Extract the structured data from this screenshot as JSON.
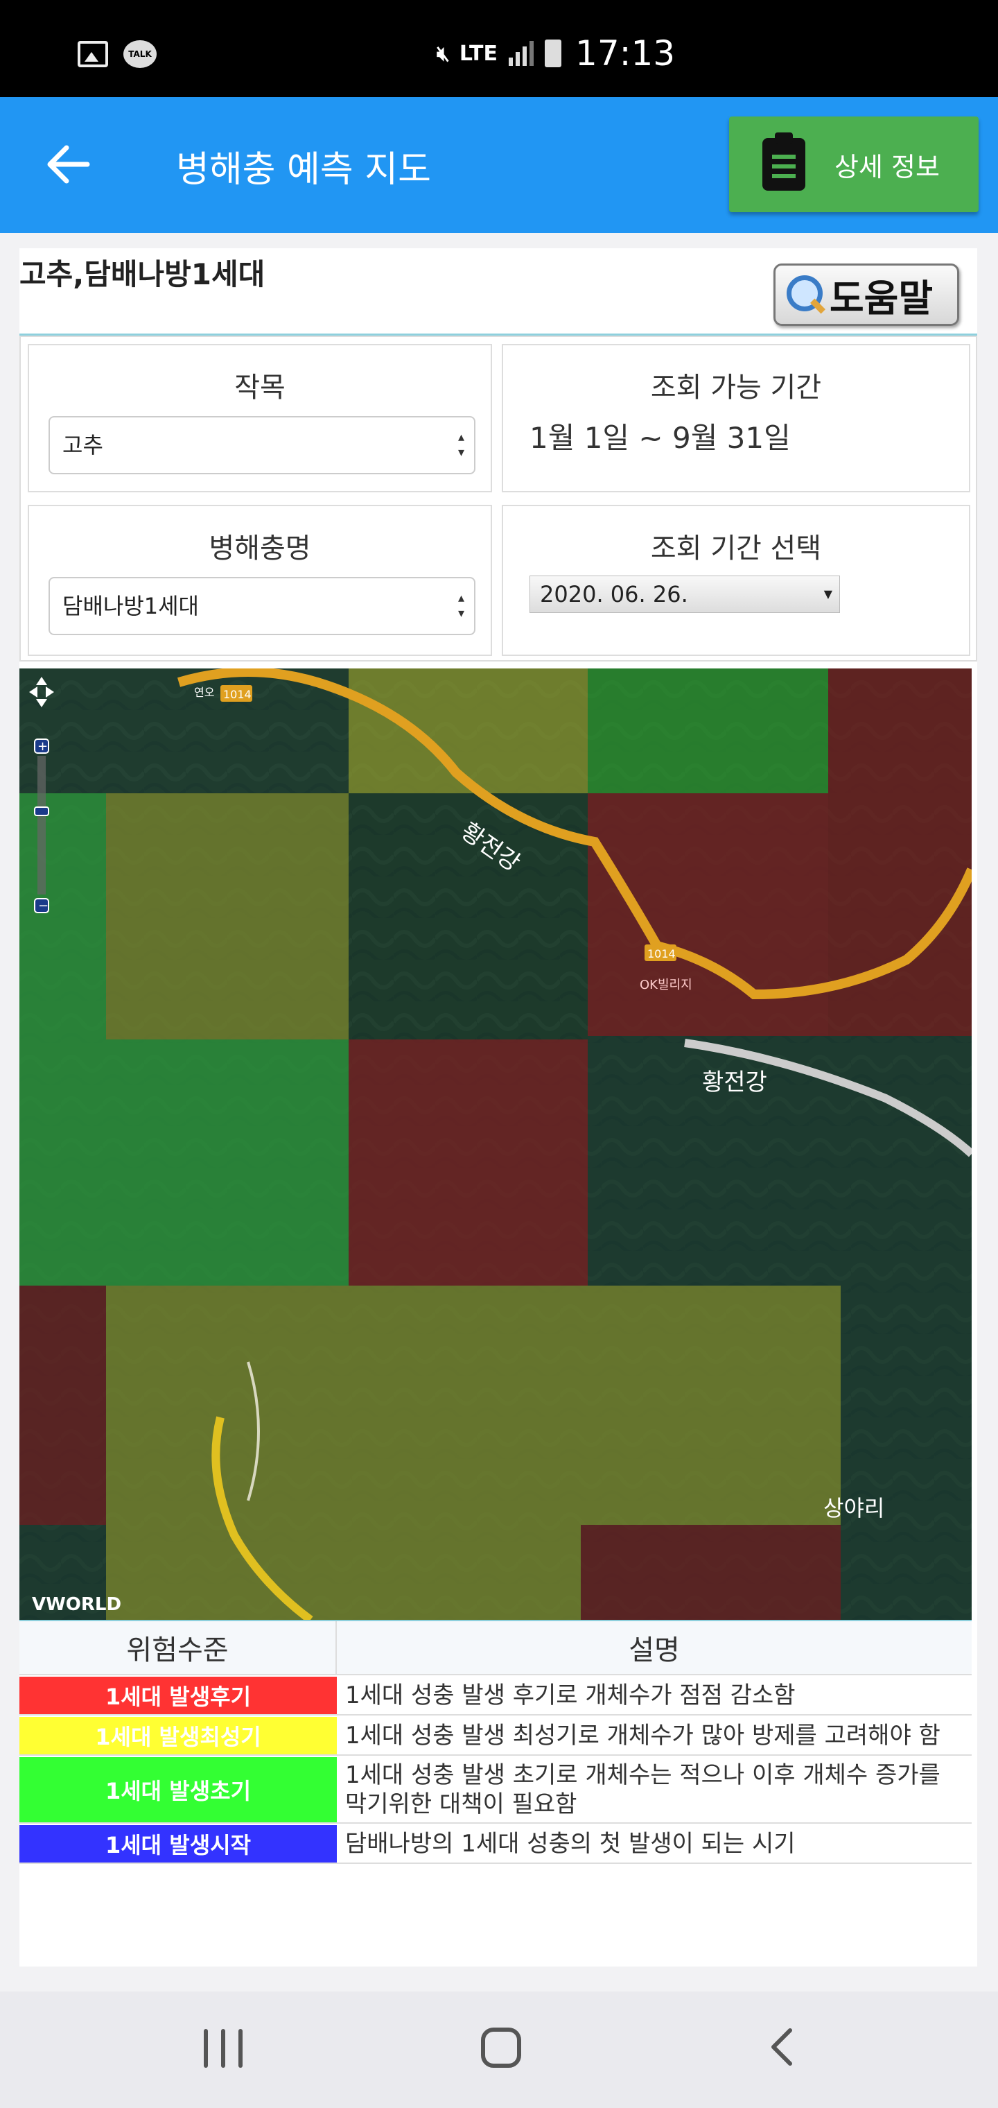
{
  "status_bar": {
    "left_icons": [
      "gallery-icon",
      "talk-icon"
    ],
    "talk_text": "TALK",
    "network": "LTE",
    "time": "17:13"
  },
  "app_bar": {
    "title": "병해충 예측 지도",
    "detail_button": "상세 정보"
  },
  "header": {
    "crop_pest_title": "고추,담배나방1세대",
    "help_button": "도움말"
  },
  "filters": {
    "crop_label": "작목",
    "crop_value": "고추",
    "available_period_label": "조회 가능 기간",
    "available_period_value": "1월 1일 ~ 9월 31일",
    "pest_label": "병해충명",
    "pest_value": "담배나방1세대",
    "period_select_label": "조회 기간 선택",
    "period_select_value": "2020. 06. 26."
  },
  "map": {
    "labels": {
      "road_number": "1014",
      "river_1": "황전강",
      "river_2": "황전강",
      "village": "OK빌리지",
      "place": "상야리",
      "small_river": "황전강",
      "brand": "VWORLD",
      "left_top": "연오"
    },
    "risk_grid_colors": {
      "late": "#e43c3c",
      "peak": "#e8e83a",
      "early": "#2fd23f",
      "start": "#3030f0",
      "none": "#1d3a30"
    }
  },
  "legend": {
    "header_level": "위험수준",
    "header_desc": "설명",
    "rows": [
      {
        "level": "1세대 발생후기",
        "color": "#ff3333",
        "desc": "1세대 성충 발생 후기로 개체수가 점점 감소함"
      },
      {
        "level": "1세대 발생최성기",
        "color": "#ffff33",
        "desc": "1세대 성충 발생 최성기로 개체수가 많아 방제를 고려해야 함"
      },
      {
        "level": "1세대 발생초기",
        "color": "#33ff33",
        "desc": "1세대 성충 발생 초기로 개체수는 적으나 이후 개체수 증가를 막기위한 대책이 필요함"
      },
      {
        "level": "1세대 발생시작",
        "color": "#3333ff",
        "desc": "담배나방의 1세대 성충의 첫 발생이 되는 시기"
      }
    ]
  }
}
